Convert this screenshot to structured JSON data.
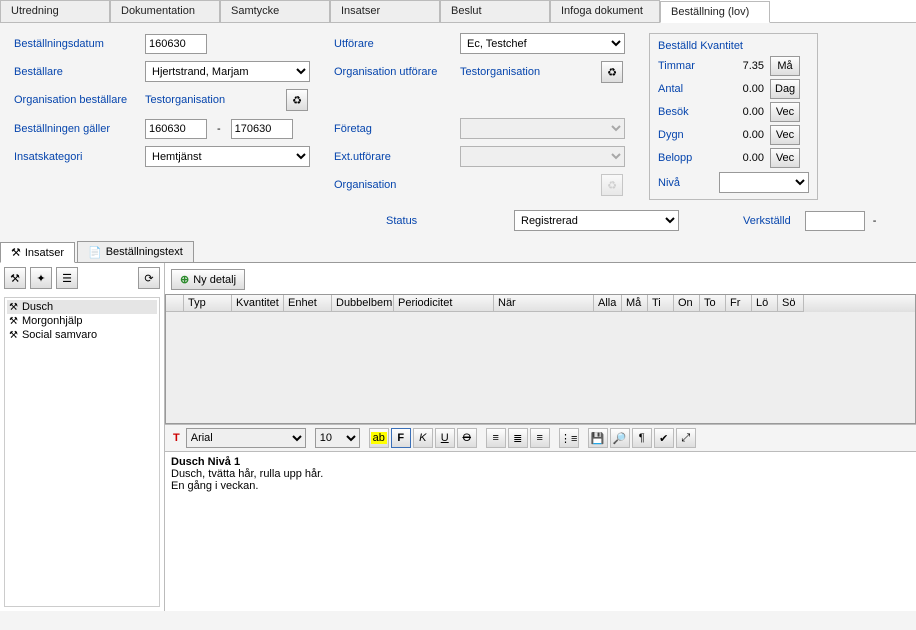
{
  "top_tabs": {
    "utredning": "Utredning",
    "dokumentation": "Dokumentation",
    "samtycke": "Samtycke",
    "insatser": "Insatser",
    "beslut": "Beslut",
    "infoga": "Infoga dokument",
    "bestallning": "Beställning (lov)"
  },
  "form": {
    "bestallningsdatum_lbl": "Beställningsdatum",
    "bestallningsdatum_val": "160630",
    "bestallare_lbl": "Beställare",
    "bestallare_val": "Hjertstrand, Marjam",
    "org_bestallare_lbl": "Organisation beställare",
    "org_bestallare_val": "Testorganisation",
    "galler_lbl": "Beställningen gäller",
    "galler_from": "160630",
    "galler_to": "170630",
    "insatskategori_lbl": "Insatskategori",
    "insatskategori_val": "Hemtjänst",
    "utforare_lbl": "Utförare",
    "utforare_val": "Ec, Testchef",
    "org_utforare_lbl": "Organisation utförare",
    "org_utforare_val": "Testorganisation",
    "foretag_lbl": "Företag",
    "ext_utforare_lbl": "Ext.utförare",
    "organisation_lbl": "Organisation",
    "status_lbl": "Status",
    "status_val": "Registrerad",
    "verkstalld_lbl": "Verkställd"
  },
  "qty": {
    "title": "Beställd Kvantitet",
    "timmar_lbl": "Timmar",
    "timmar_val": "7.35",
    "timmar_unit": "Må",
    "antal_lbl": "Antal",
    "antal_val": "0.00",
    "antal_unit": "Dag",
    "besok_lbl": "Besök",
    "besok_val": "0.00",
    "besok_unit": "Vec",
    "dygn_lbl": "Dygn",
    "dygn_val": "0.00",
    "dygn_unit": "Vec",
    "belopp_lbl": "Belopp",
    "belopp_val": "0.00",
    "belopp_unit": "Vec",
    "niva_lbl": "Nivå"
  },
  "sub_tabs": {
    "insatser": "Insatser",
    "bestallningstext": "Beställningstext"
  },
  "tree": {
    "dusch": "Dusch",
    "morgon": "Morgonhjälp",
    "social": "Social samvaro"
  },
  "detail_btn": "Ny detalj",
  "grid_cols": {
    "typ": "Typ",
    "kvantitet": "Kvantitet",
    "enhet": "Enhet",
    "dubbel": "Dubbelbem",
    "period": "Periodicitet",
    "nar": "När",
    "alla": "Alla",
    "ma": "Må",
    "ti": "Ti",
    "on": "On",
    "to": "To",
    "fr": "Fr",
    "lo": "Lö",
    "so": "Sö"
  },
  "editor_font": "Arial",
  "editor_size": "10",
  "editor": {
    "title": "Dusch Nivå 1",
    "line1": "Dusch, tvätta hår, rulla upp hår.",
    "line2": "En gång i veckan."
  }
}
